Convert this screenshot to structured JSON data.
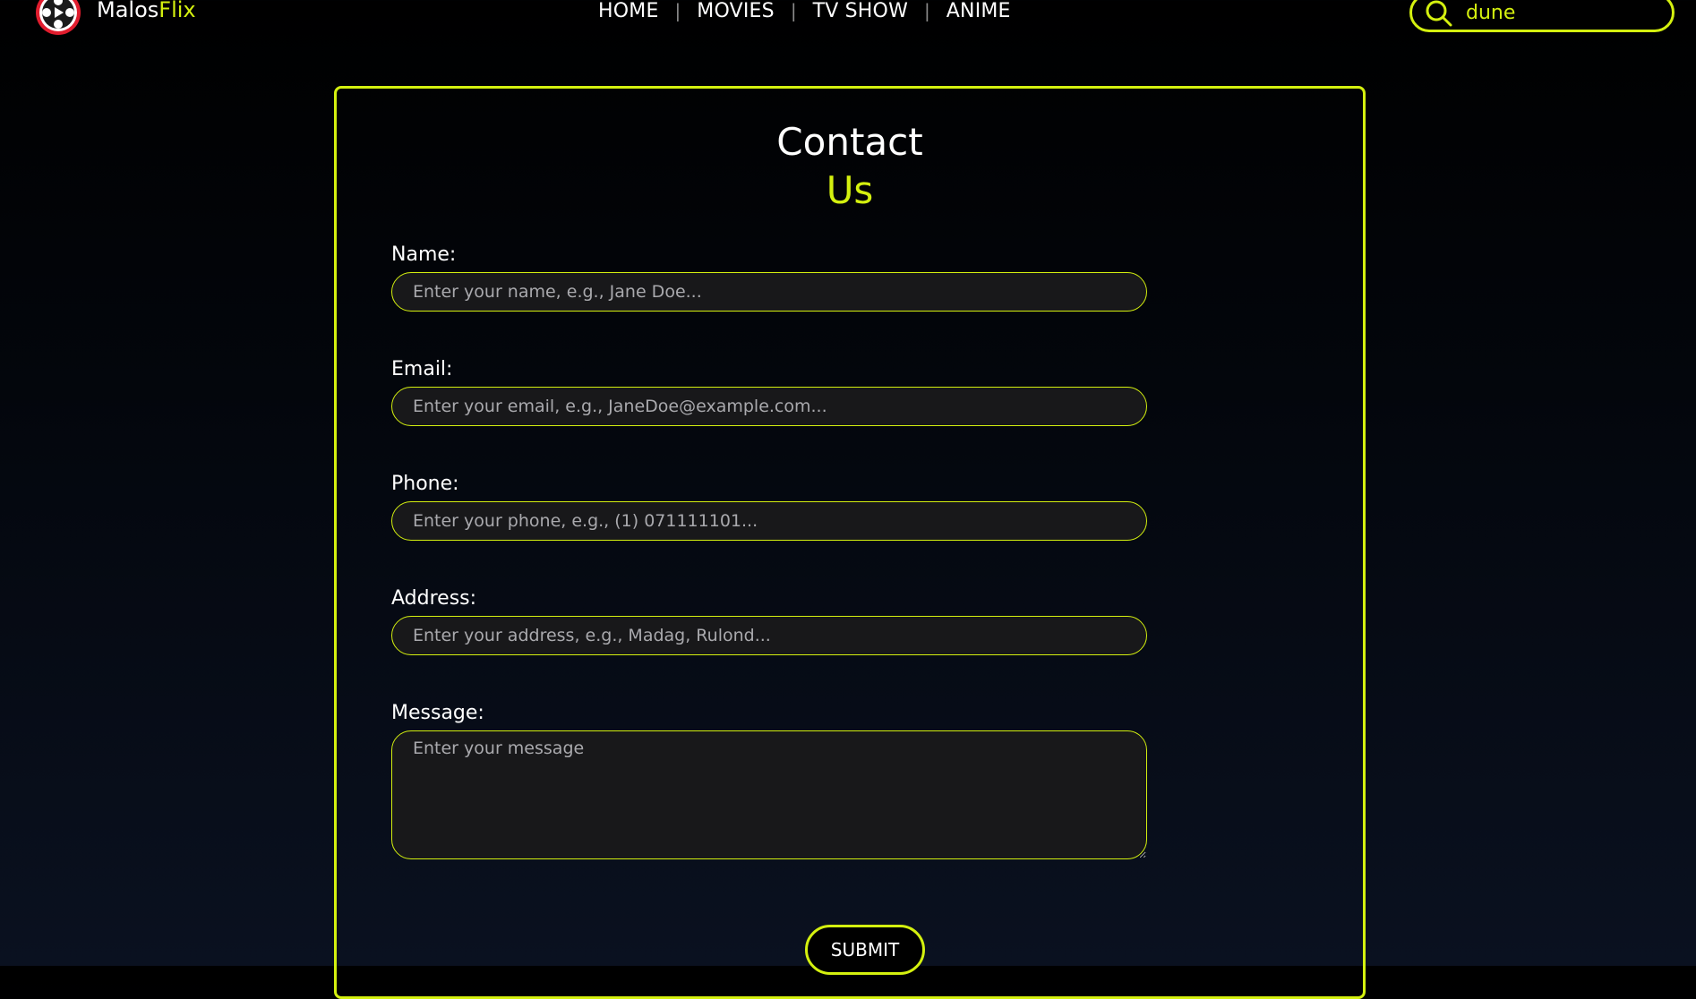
{
  "header": {
    "brand_primary": "Malos",
    "brand_accent": "Flix",
    "logo_icon": "film-reel-icon",
    "nav": [
      {
        "label": "HOME"
      },
      {
        "label": "MOVIES"
      },
      {
        "label": "TV SHOW"
      },
      {
        "label": "ANIME"
      }
    ],
    "nav_separator": "|",
    "search": {
      "value": "dune",
      "icon": "search-icon"
    }
  },
  "contact": {
    "title_line1": "Contact",
    "title_line2": "Us",
    "fields": [
      {
        "label": "Name:",
        "placeholder": "Enter your name, e.g., Jane Doe..."
      },
      {
        "label": "Email:",
        "placeholder": "Enter your email, e.g., JaneDoe@example.com..."
      },
      {
        "label": "Phone:",
        "placeholder": "Enter your phone, e.g., (1) 071111101..."
      },
      {
        "label": "Address:",
        "placeholder": "Enter your address, e.g., Madag, Rulond..."
      },
      {
        "label": "Message:",
        "placeholder": "Enter your message"
      }
    ],
    "submit_label": "SUBMIT"
  },
  "colors": {
    "accent": "#d4f00f",
    "background": "#000000",
    "input_background": "#18181a",
    "text": "#ffffff"
  }
}
